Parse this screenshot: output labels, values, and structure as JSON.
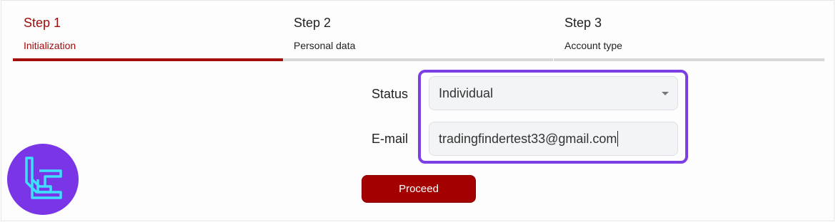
{
  "steps": [
    {
      "title": "Step 1",
      "subtitle": "Initialization",
      "active": true
    },
    {
      "title": "Step 2",
      "subtitle": "Personal data",
      "active": false
    },
    {
      "title": "Step 3",
      "subtitle": "Account type",
      "active": false
    }
  ],
  "form": {
    "status_label": "Status",
    "status_value": "Individual",
    "email_label": "E-mail",
    "email_value": "tradingfindertest33@gmail.com",
    "proceed_label": "Proceed"
  },
  "colors": {
    "accent": "#a30f0f",
    "highlight": "#7b3fe4",
    "logo_bg": "#7a35e6",
    "logo_stroke": "#3fe0ff"
  },
  "icons": {
    "status_dropdown": "chevron-down-icon",
    "logo": "tf-logo-icon"
  }
}
